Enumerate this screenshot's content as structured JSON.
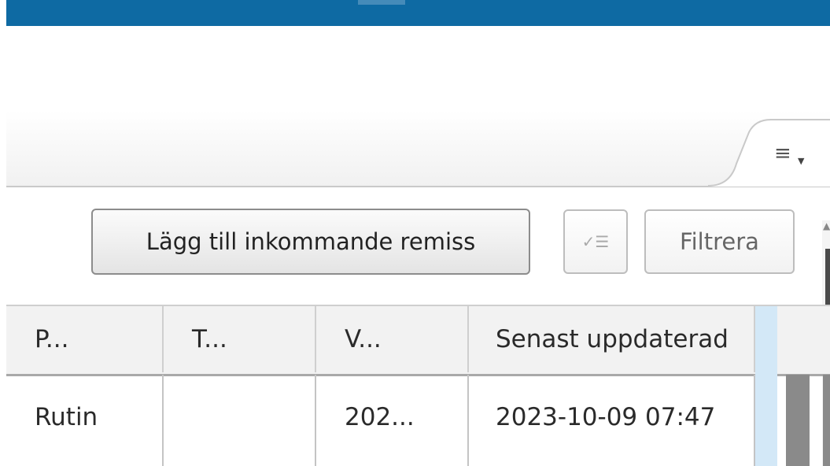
{
  "toolbar": {
    "add_referral_label": "Lägg till inkommande remiss",
    "filter_label": "Filtrera",
    "checklist_icon": "checklist-icon",
    "menu_icon": "hamburger-menu-icon"
  },
  "table": {
    "columns": [
      "P...",
      "T...",
      "V...",
      "Senast uppdaterad"
    ],
    "rows": [
      [
        "Rutin",
        "",
        "202...",
        "2023-10-09 07:47"
      ]
    ]
  },
  "colors": {
    "top_bar": "#0e6aa3",
    "selection": "#d3e8f7"
  }
}
